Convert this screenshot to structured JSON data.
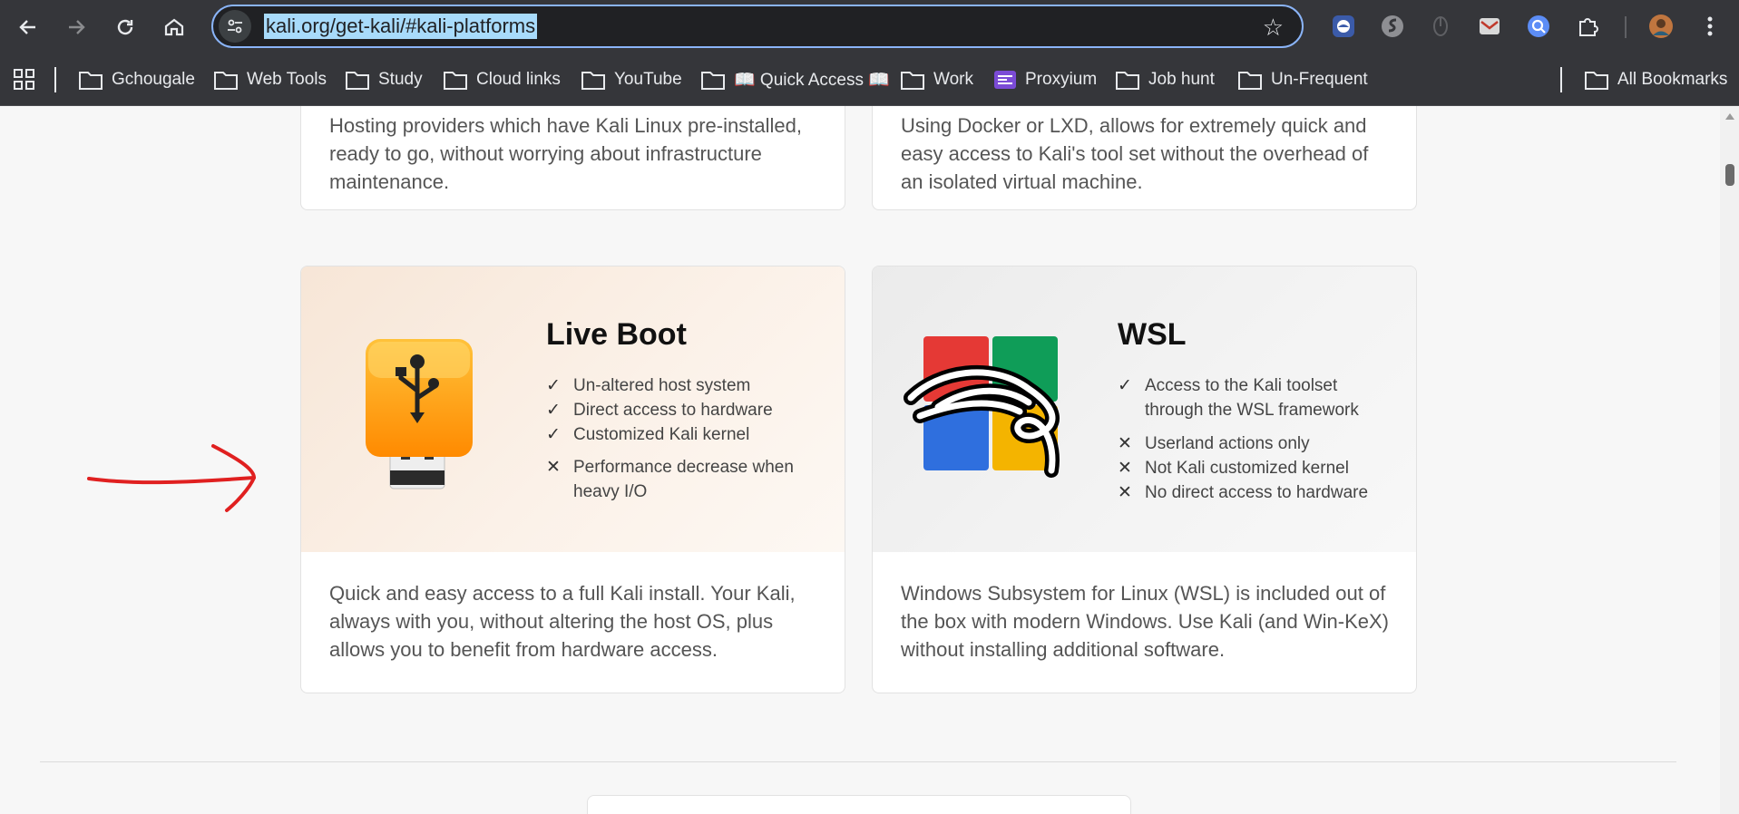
{
  "browser": {
    "url": "kali.org/get-kali/#kali-platforms",
    "bookmarks": [
      {
        "label": "Gchougale"
      },
      {
        "label": "Web Tools"
      },
      {
        "label": "Study"
      },
      {
        "label": "Cloud links"
      },
      {
        "label": "YouTube"
      },
      {
        "label": "📖 Quick Access 📖"
      },
      {
        "label": "Work"
      },
      {
        "label": "Proxyium"
      },
      {
        "label": "Job hunt"
      },
      {
        "label": "Un-Frequent"
      }
    ],
    "all_bookmarks": "All Bookmarks"
  },
  "top_cards": {
    "left_text": "Hosting providers which have Kali Linux pre-installed, ready to go, without worrying about infrastructure maintenance.",
    "right_text": "Using Docker or LXD, allows for extremely quick and easy access to Kali's tool set without the overhead of an isolated virtual machine."
  },
  "live_boot": {
    "title": "Live Boot",
    "features": [
      {
        "mark": "✓",
        "text": "Un-altered host system"
      },
      {
        "mark": "✓",
        "text": "Direct access to hardware"
      },
      {
        "mark": "✓",
        "text": "Customized Kali kernel"
      },
      {
        "mark": "✕",
        "text": "Performance decrease when heavy I/O"
      }
    ],
    "description": "Quick and easy access to a full Kali install. Your Kali, always with you, without altering the host OS, plus allows you to benefit from hardware access."
  },
  "wsl": {
    "title": "WSL",
    "features": [
      {
        "mark": "✓",
        "text": "Access to the Kali toolset through the WSL framework"
      },
      {
        "mark": "✕",
        "text": "Userland actions only"
      },
      {
        "mark": "✕",
        "text": "Not Kali customized kernel"
      },
      {
        "mark": "✕",
        "text": "No direct access to hardware"
      }
    ],
    "description": "Windows Subsystem for Linux (WSL) is included out of the box with modern Windows. Use Kali (and Win-KeX) without installing additional software."
  },
  "colors": {
    "chrome_bg": "#35363a",
    "url_highlight": "#a8dbfb",
    "usb_orange": "#ff9800",
    "annotation_red": "#e02020"
  }
}
